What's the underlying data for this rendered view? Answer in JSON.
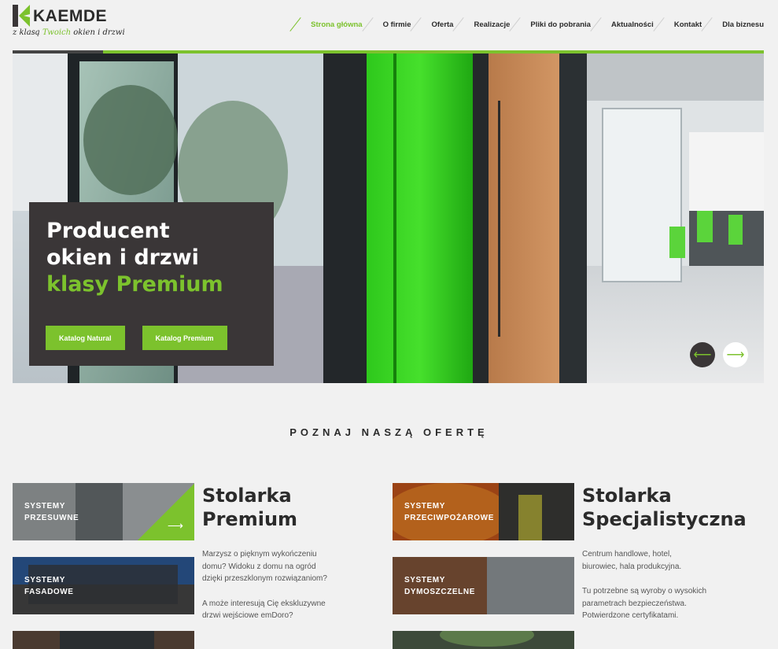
{
  "logo": {
    "name": "KAEMDE",
    "tagline_pre": "z klasą",
    "tagline_hl": "Twoich",
    "tagline_post": "okien i drzwi"
  },
  "nav": [
    {
      "label": "Strona główna",
      "active": true
    },
    {
      "label": "O firmie"
    },
    {
      "label": "Oferta"
    },
    {
      "label": "Realizacje"
    },
    {
      "label": "Pliki do pobrania"
    },
    {
      "label": "Aktualności"
    },
    {
      "label": "Kontakt"
    },
    {
      "label": "Dla biznesu"
    }
  ],
  "hero": {
    "title_line1": "Producent",
    "title_line2": "okien i drzwi",
    "title_line3": "klasy Premium",
    "btn1": "Katalog Natural",
    "btn2": "Katalog Premium",
    "prev_icon": "arrow-left-icon",
    "next_icon": "arrow-right-icon"
  },
  "offer": {
    "title": "POZNAJ NASZĄ OFERTĘ",
    "left": {
      "tiles": [
        {
          "line1": "SYSTEMY",
          "line2": "PRZESUWNE"
        },
        {
          "line1": "SYSTEMY",
          "line2": "FASADOWE"
        }
      ],
      "heading1": "Stolarka",
      "heading2": "Premium",
      "p1": "Marzysz o pięknym wykończeniu domu? Widoku z domu na ogród dzięki przeszklonym rozwiązaniom?",
      "p2": "A może interesują Cię ekskluzywne drzwi wejściowe emDoro?"
    },
    "right": {
      "tiles": [
        {
          "line1": "SYSTEMY",
          "line2": "PRZECIWPOŻAROWE"
        },
        {
          "line1": "SYSTEMY",
          "line2": "DYMOSZCZELNE"
        }
      ],
      "heading1": "Stolarka",
      "heading2": "Specjalistyczna",
      "p1": "Centrum handlowe, hotel, biurowiec, hala produkcyjna.",
      "p2": "Tu potrzebne są wyroby o wysokich parametrach bezpieczeństwa. Potwierdzone certyfikatami."
    }
  },
  "colors": {
    "accent": "#7cc22d",
    "dark": "#3a3637",
    "bg": "#f1f1f1"
  }
}
